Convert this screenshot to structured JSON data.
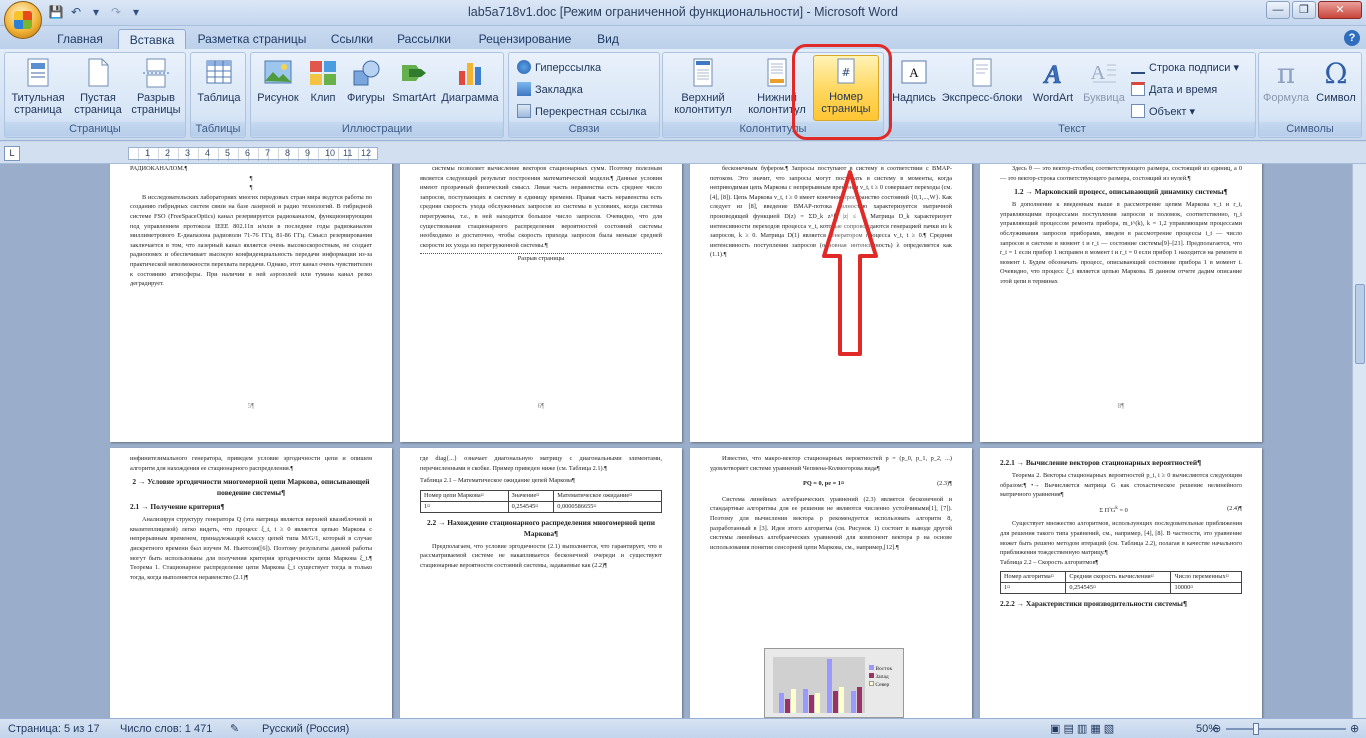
{
  "window": {
    "title": "lab5a718v1.doc [Режим ограниченной функциональности] - Microsoft Word"
  },
  "tabs": [
    "Главная",
    "Вставка",
    "Разметка страницы",
    "Ссылки",
    "Рассылки",
    "Рецензирование",
    "Вид"
  ],
  "active_tab": "Вставка",
  "ribbon": {
    "pages_group": {
      "label": "Страницы",
      "cover": "Титульная страница",
      "blank": "Пустая страница",
      "break": "Разрыв страницы"
    },
    "tables_group": {
      "label": "Таблицы",
      "table": "Таблица"
    },
    "illustrations_group": {
      "label": "Иллюстрации",
      "picture": "Рисунок",
      "clip": "Клип",
      "shapes": "Фигуры",
      "smartart": "SmartArt",
      "chart": "Диаграмма"
    },
    "links_group": {
      "label": "Связи",
      "hyperlink": "Гиперссылка",
      "bookmark": "Закладка",
      "crossref": "Перекрестная ссылка"
    },
    "headers_group": {
      "label": "Колонтитулы",
      "header": "Верхний колонтитул",
      "footer": "Нижний колонтитул",
      "page_number": "Номер страницы"
    },
    "text_group": {
      "label": "Текст",
      "textbox": "Надпись",
      "quickparts": "Экспресс-блоки",
      "wordart": "WordArt",
      "dropcap": "Буквица",
      "signature": "Строка подписи",
      "datetime": "Дата и время",
      "object": "Объект"
    },
    "symbols_group": {
      "label": "Символы",
      "formula": "Формула",
      "symbol": "Символ"
    }
  },
  "ruler": {
    "numbers": [
      "1",
      "2",
      "3",
      "4",
      "5",
      "6",
      "7",
      "8",
      "9",
      "10",
      "11",
      "12"
    ]
  },
  "pages": {
    "p1": {
      "top": "РАДИОКАНАЛОМ.¶",
      "body": "В исследовательских лабораториях многих передовых стран мира ведутся работы по созданию гибридных систем связи на базе лазерной и радио технологий. В гибридной системе FSO (FreeSpaceOptics) канал резервируется радиоканалом, функционирующим под управлением протокола IEEE 802.11n и/или в последнее годы радиоканалом миллиметрового Е-диапазона радиоволн 71-76 ГГц, 81-86 ГГц. Смысл резервирования заключается в том, что лазерный канал является очень высокоскоростным, не создает радиопомех и обеспечивает высокую конфиденциальность передачи информации из-за практической невозможности перехвата передачи. Однако, этот канал очень чувствителен к состоянию атмосферы. При наличии в ней аэрозолей или тумана канал резко деградирует.",
      "num": "5¶"
    },
    "p2": {
      "body": "системы позволяет вычисление векторов стационарных сумм. Поэтому полезным является следующий результат построения математической модели.¶ Данные условия имеют прозрачный физический смысл. Левая часть неравенства есть среднее число запросов, поступающих в систему в единицу времени. Правая часть неравенства есть средняя скорость ухода обслуженных запросов из системы в условиях, когда система перегружена, т.е., в ней находится большое число запросов. Очевидно, что для существования стационарного распределения вероятностей состояний системы необходимо и достаточно, чтобы скорость прихода запросов была меньше средней скорости их ухода из перегруженной системы.¶",
      "break": "Разрыв страницы",
      "num": "6¶"
    },
    "p3": {
      "body": "бесконечным буфером.¶ Запросы поступают в систему в соответствии с BMAP-потоком. Это значит, что запросы могут поступать в систему в моменты, когда неприводимая цепь Маркова с непрерывным временем v_t, t ≥ 0 совершает переходы (см. [4], [8]). Цепь Маркова v_t, t ≥ 0 имеет конечное пространство состояний {0,1,...,W}. Как следует из [8], введение BMAP-потока полностью характеризуется матричной производящей функцией D(z) = ΣD_k z^k, |z| ≤ 1. Матрица D_k характеризует интенсивности переходов процесса v_t, которые сопровождаются генерацией пачки из k запросов, k ≥ 0. Матрица D(1) является генератором процесса v_t, t ≥ 0.¶ Средняя интенсивность поступления запросов (основная интенсивность) λ определяется как (1.1).¶"
    },
    "p4": {
      "body1": "Здесь θ — это вектор-столбец соответствующего размера, состоящий из единиц, а 0 — это вектор-строка соответствующего размера, состоящий из нулей.¶",
      "heading": "1.2 → Марковский процесс, описывающий динамику системы¶",
      "body2": "В дополнение к введенным выше в рассмотрение цепям Маркова v_t и r_t, управляющими процессами поступления запросов и поломок, соответственно, η_t управляющий процессом ремонта прибора, m_t^(k), k = 1,2 управляющим процессами обслуживания запросов приборами, введем в рассмотрение процессы i_t — число запросов в системе в момент t и r_t — состояние системы[9]–[21]. Предполагается, что r_t = 1 если прибор 1 исправен в момент t и r_t = 0 если прибор 1 находится на ремонте в момент t. Будем обозначать процесс, описывающий состояние прибора 1 в момент t. Очевидно, что процесс ξ_t является цепью Маркова. В данном отчете дадим описание этой цепи в терминах",
      "num": "8¶"
    },
    "p5": {
      "body1": "инфинитезимального генератора, приведем условие эргодичности цепи и опишем алгоритм для нахождения ее стационарного распределения.¶",
      "heading": "2 → Условие эргодичности многомерной цепи Маркова, описывающей поведение системы¶",
      "sub": "2.1 → Получение критерия¶",
      "body2": "Анализируя структуру генератора Q (эта матрица является верхней квазиблочной и квазитеплицевой) легко видеть, что процесс ξ_t, t ≥ 0 является цепью Маркова с непрерывным временем, принадлежащей классу цепей типа M/G/1, который в случае дискретного времени был изучен M. Ньютсом([6]). Поэтому результаты данной работы могут быть использованы для получения критерия эргодичности цепи Маркова ξ_t.¶ Теорема 1. Стационарное распределение цепи Маркова ξ_t существует тогда и только тогда, когда выполняется неравенство (2.1)¶"
    },
    "p6": {
      "body1": "где diag{...} означает диагональную матрицу с диагональными элементами, перечисленными в скобке. Пример приведен ниже (см. Таблица 2.1).¶",
      "caption": "Таблица 2.1 – Математическое ожидание цепей Маркова¶",
      "table": [
        [
          "Номер цепи Маркова¤",
          "Значение¤",
          "Математическое ожидание¤"
        ],
        [
          "1¤",
          "0,254545¤",
          "0,0000586655¤"
        ]
      ],
      "heading": "2.2 → Нахождение стационарного распределения многомерной цепи Маркова¶",
      "body2": "Предполагаем, что условие эргодичности (2.1) выполняется, что гарантирует, что в рассматриваемой системе не накапливается бесконечной очереди и существуют стационарные вероятности состояний системы, задаваемые как (2.2)¶"
    },
    "p7": {
      "body1": "Известно, что макро-вектор стационарных вероятностей p = (p_0, p_1, p_2, ...) удовлетворяет системе уравнений Чепмена-Колмогорова вида¶",
      "eq": "PQ = 0, pe = 1¤",
      "eqn": "(2.3)¶",
      "body2": "Система линейных алгебраических уравнений (2.3) является бесконечной и стандартные алгоритмы для ее решения не являются численно устойчивыми[1], [7]). Поэтому для вычисления вектора p рекомендуется использовать алгоритм 8, разработанный в [3]. Идея этого алгоритма (см. Рисунок 1) состоит в выводе другой системы линейных алгебраических уравнений для компонент вектора p на основе использования понятия сенсорной цепи Маркова, см., например,[12].¶",
      "legend": [
        "Восток",
        "Запад",
        "Север"
      ]
    },
    "p8": {
      "heading": "2.2.1 → Вычисление векторов стационарных вероятностей¶",
      "body1": "Теорема 2. Векторы стационарных вероятностей p_i, i ≥ 0 вычисляются следующим образом:¶ •→ Вычисляется матрица G как стохастическое решение нелинейного матричного уравнения¶",
      "eqn": "(2.4)¶",
      "body2": "Существует множество алгоритмов, использующих последовательные приближения для решения такого типа уравнений, см., например, [4], [8]. В частности, это уравнение может быть решено методом итераций (см. Таблица 2.2), полагая в качестве начального приближения тождественную матрицу.¶",
      "caption": "Таблица 2.2 – Скорость алгоритмов¶",
      "table": [
        [
          "Номер алгоритма¤",
          "Средняя скорость вычисления¤",
          "Число переменных¤"
        ],
        [
          "1¤",
          "0,254545¤",
          "10000¤"
        ]
      ],
      "footer": "2.2.2 → Характеристики производительности системы¶"
    }
  },
  "status": {
    "page": "Страница: 5 из 17",
    "words": "Число слов: 1 471",
    "lang": "Русский (Россия)",
    "zoom": "50%",
    "zoom_level": 0.5
  }
}
